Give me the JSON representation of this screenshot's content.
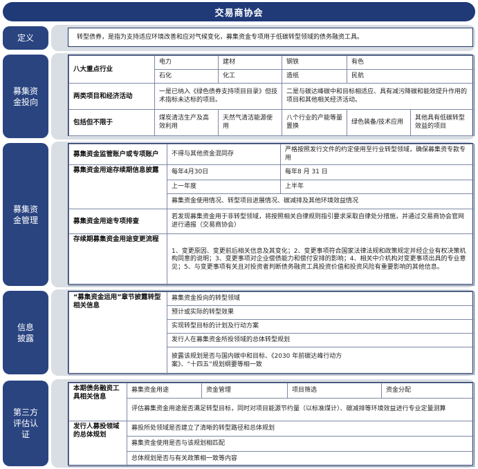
{
  "header": {
    "title": "交易商协会"
  },
  "sections": {
    "definition": {
      "label": "定义",
      "text": "转型债券，是指为支持适应环境改善和应对气候变化，募集资金专项用于低碳转型领域的债务融资工具。"
    },
    "fund_use": {
      "label": "募集资\n金投向",
      "industries_header": "八大重点行业",
      "industries": [
        "电力",
        "建材",
        "钢铁",
        "有色",
        "石化",
        "化工",
        "造纸",
        "民航"
      ],
      "two_types_header": "两类项目和经济活动",
      "two_types": [
        "一是已纳入《绿色债券支持项目目录》但技术指标未达标的项目。",
        "二是与碳达峰碳中和目标相适应、具有减污降碳和能效提升作用的项目和其他相关经济活动。"
      ],
      "includes_header": "包括但不限于",
      "includes": [
        "煤炭清洁生产及高效利用",
        "天然气清洁能源使用",
        "八个行业的产能等量置换",
        "绿色装备/技术应用",
        "其他具有低碳转型效益的项目"
      ]
    },
    "fund_management": {
      "label": "募集资\n金管理",
      "account_header": "募集资金监管账户或专项账户",
      "account": [
        "不得与其他资金混同存",
        "严格按照发行文件的约定使用至行业转型领域，确保募集资专款专用"
      ],
      "disclosure_header": "募集资金用途存续期信息披露",
      "disclosure_dates": [
        "每年4月30日",
        "每年8 月 31 日"
      ],
      "disclosure_periods": [
        "上一年度",
        "上半年"
      ],
      "disclosure_content": "募集资金使用情况、转型项目进展情况、碳减排及其他环境效益情况",
      "inspection_header": "募集资金用途专项排查",
      "inspection": "若发现募集资金用于非转型领域，将按照相关自律规则指引要求采取自律处分措施，并通过交易商协会官网进行通报（交易商协会）",
      "change_header": "存续期募集资金用途变更流程",
      "change": "1、变更原因、变更前后相关信息及其变化；2、变更事项符合国家法律法规和政策规定并经企业有权决策机构同意的说明；3、变更事项对企业偿债能力和偿付安排的影响；4、相关中介机构对变更事项出具的专业意见；5、与变更事项有关且对投资者判断债务融资工具投资价值和投资风险有重要影响的其他信息。"
    },
    "disclosure": {
      "label": "信息\n披露",
      "header": "“募集资金运用”章节披露转型相关信息",
      "items": [
        "募集资金投向的转型领域",
        "预计或实际的转型效果",
        "实现转型目标的计划及行动方案",
        "发行人在募集资金所投领域的总体转型规划",
        "披露该规划是否与国内碳中和目标、《2030 年前碳达峰行动方案》、“十四五”规划纲要等相一致"
      ]
    },
    "third_party": {
      "label": "第三方\n评估认\n证",
      "tool_header": "本期债务融资工具相关信息",
      "tool_items": [
        "募集资金用途",
        "资金管理",
        "项目筛选",
        "资金分配"
      ],
      "tool_note": "评估募集资金用途是否满足转型目标，同时对项目能源节约量（以标准煤计）、碳减排等环境效益进行专业定量测算",
      "issuer_header": "发行人募投领域的总体规划",
      "issuer_items": [
        "募投所处领域是否建立了清晰的转型路径和总体规划",
        "募集资金使用是否与该规划相匹配",
        "总体规划是否与有关政策相一致等内容"
      ]
    }
  }
}
